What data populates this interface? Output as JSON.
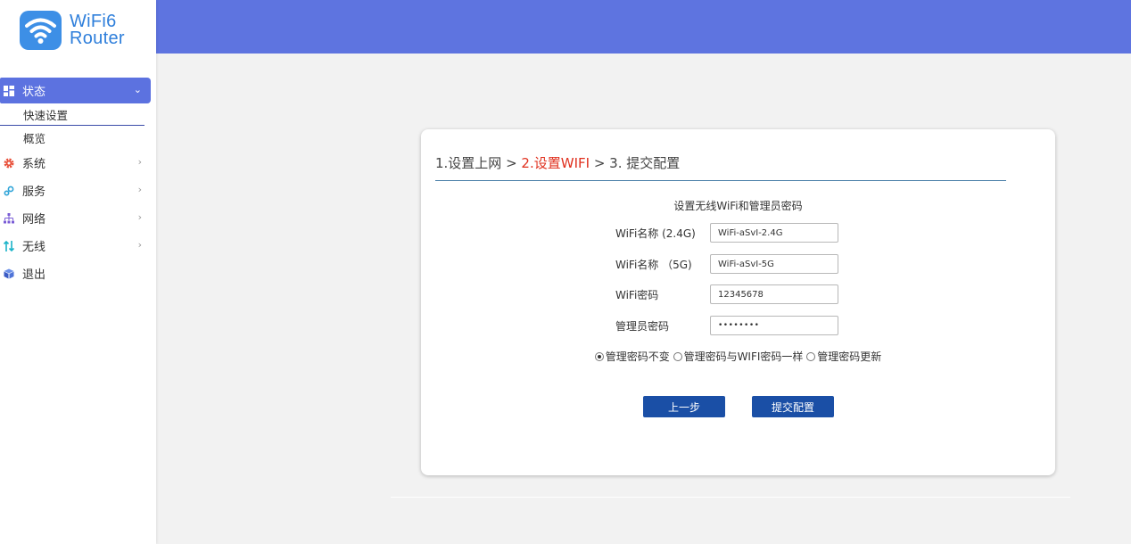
{
  "logo": {
    "line1": "WiFi6",
    "line2": "Router",
    "color": "#3d8fe6"
  },
  "sidebar": {
    "items": [
      {
        "label": "状态",
        "icon": "dashboard-icon",
        "active": true
      },
      {
        "label": "系统",
        "icon": "gear-icon"
      },
      {
        "label": "服务",
        "icon": "services-icon"
      },
      {
        "label": "网络",
        "icon": "network-icon"
      },
      {
        "label": "无线",
        "icon": "wireless-icon"
      },
      {
        "label": "退出",
        "icon": "logout-icon"
      }
    ],
    "sub_items": [
      {
        "label": "快速设置",
        "current": true
      },
      {
        "label": "概览"
      }
    ]
  },
  "theme": {
    "header": "#5e74e0",
    "accent": "#1a4fa6",
    "step_current": "#e0301e"
  },
  "wizard": {
    "step1": "1.设置上网 > ",
    "step2": "2.设置WIFI",
    "step3": " > 3. 提交配置"
  },
  "form": {
    "title": "设置无线WiFi和管理员密码",
    "fields": [
      {
        "label": "WiFi名称 (2.4G)",
        "value": "WiFi-aSvI-2.4G"
      },
      {
        "label": "WiFi名称 （5G)",
        "value": "WiFi-aSvI-5G"
      },
      {
        "label": "WiFi密码",
        "value": "12345678"
      },
      {
        "label": "管理员密码",
        "value": "••••••••"
      }
    ],
    "radios": [
      {
        "label": "管理密码不变",
        "checked": true
      },
      {
        "label": "管理密码与WIFI密码一样",
        "checked": false
      },
      {
        "label": "管理密码更新",
        "checked": false
      }
    ],
    "prev_label": "上一步",
    "submit_label": "提交配置"
  }
}
